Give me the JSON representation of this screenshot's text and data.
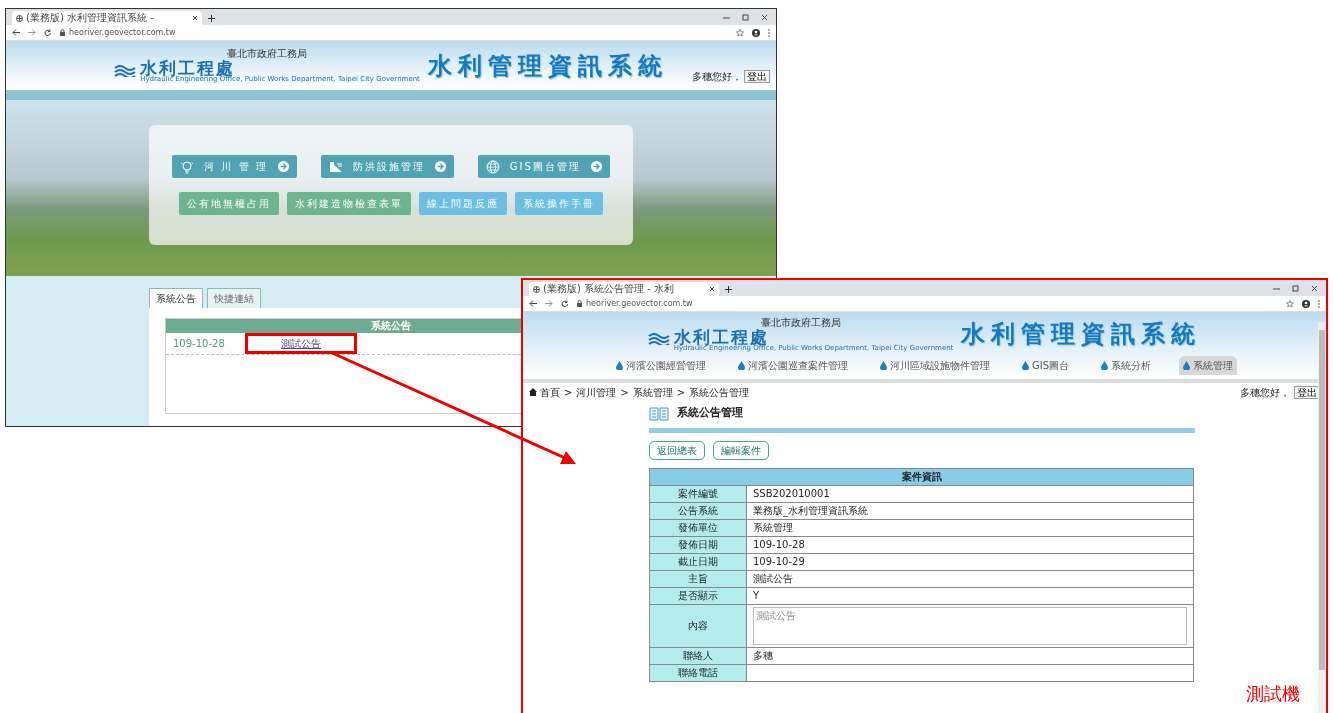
{
  "home_window": {
    "tab_title": "(業務版) 水利管理資訊系統 -",
    "url": "heoriver.geovector.com.tw",
    "header": {
      "agency": "臺北市政府工務局",
      "logo_text": "水利工程處",
      "logo_subtitle": "Hydraulic Engineering Office, Public Works Department, Taipei City Government",
      "system_title": "水利管理資訊系統",
      "greeting": "多穗您好，",
      "logout": "登出"
    },
    "main_buttons": [
      {
        "label": "河 川 管 理",
        "kind": "module"
      },
      {
        "label": "防洪設施管理",
        "kind": "module"
      },
      {
        "label": "GIS圖台管理",
        "kind": "module"
      },
      {
        "label": "公有地無權占用",
        "kind": "form"
      },
      {
        "label": "水利建造物檢查表單",
        "kind": "form"
      },
      {
        "label": "線上問題反應",
        "kind": "help"
      },
      {
        "label": "系統操作手冊",
        "kind": "help"
      }
    ],
    "panel_tabs": [
      {
        "label": "系統公告",
        "selected": true
      },
      {
        "label": "快捷連結",
        "selected": false
      }
    ],
    "announcements": {
      "title": "系統公告",
      "rows": [
        {
          "date": "109-10-28",
          "subject": "測試公告",
          "highlighted": true
        }
      ]
    }
  },
  "detail_window": {
    "tab_title": "(業務版) 系統公告管理 - 水利",
    "url": "heoriver.geovector.com.tw",
    "header": {
      "agency": "臺北市政府工務局",
      "logo_text": "水利工程處",
      "logo_subtitle": "Hydraulic Engineering Office, Public Works Department, Taipei City Government",
      "system_title": "水利管理資訊系統"
    },
    "nav_tabs": [
      {
        "label": "河濱公園經營管理",
        "selected": false
      },
      {
        "label": "河濱公園巡查案件管理",
        "selected": false
      },
      {
        "label": "河川區域設施物件管理",
        "selected": false
      },
      {
        "label": "GIS圖台",
        "selected": false
      },
      {
        "label": "系統分析",
        "selected": false
      },
      {
        "label": "系統管理",
        "selected": true
      }
    ],
    "breadcrumb": {
      "items": [
        "首頁",
        "河川管理",
        "系統管理",
        "系統公告管理"
      ],
      "separator": ">"
    },
    "greeting": "多穗您好，",
    "logout": "登出",
    "page_title": "系統公告管理",
    "buttons": [
      "返回總表",
      "編輯案件"
    ],
    "table": {
      "title": "案件資訊",
      "rows": [
        {
          "label": "案件編號",
          "value": "SSB202010001",
          "kind": "text"
        },
        {
          "label": "公告系統",
          "value": "業務版_水利管理資訊系統",
          "kind": "text"
        },
        {
          "label": "發佈單位",
          "value": "系統管理",
          "kind": "text"
        },
        {
          "label": "發佈日期",
          "value": "109-10-28",
          "kind": "text"
        },
        {
          "label": "截止日期",
          "value": "109-10-29",
          "kind": "text"
        },
        {
          "label": "主旨",
          "value": "測試公告",
          "kind": "text"
        },
        {
          "label": "是否顯示",
          "value": "Y",
          "kind": "text"
        },
        {
          "label": "內容",
          "value": "測試公告",
          "kind": "textarea"
        },
        {
          "label": "聯絡人",
          "value": "多穗",
          "kind": "text"
        },
        {
          "label": "聯絡電話",
          "kind": "text"
        }
      ]
    }
  },
  "annotation": {
    "label": "測試機"
  }
}
